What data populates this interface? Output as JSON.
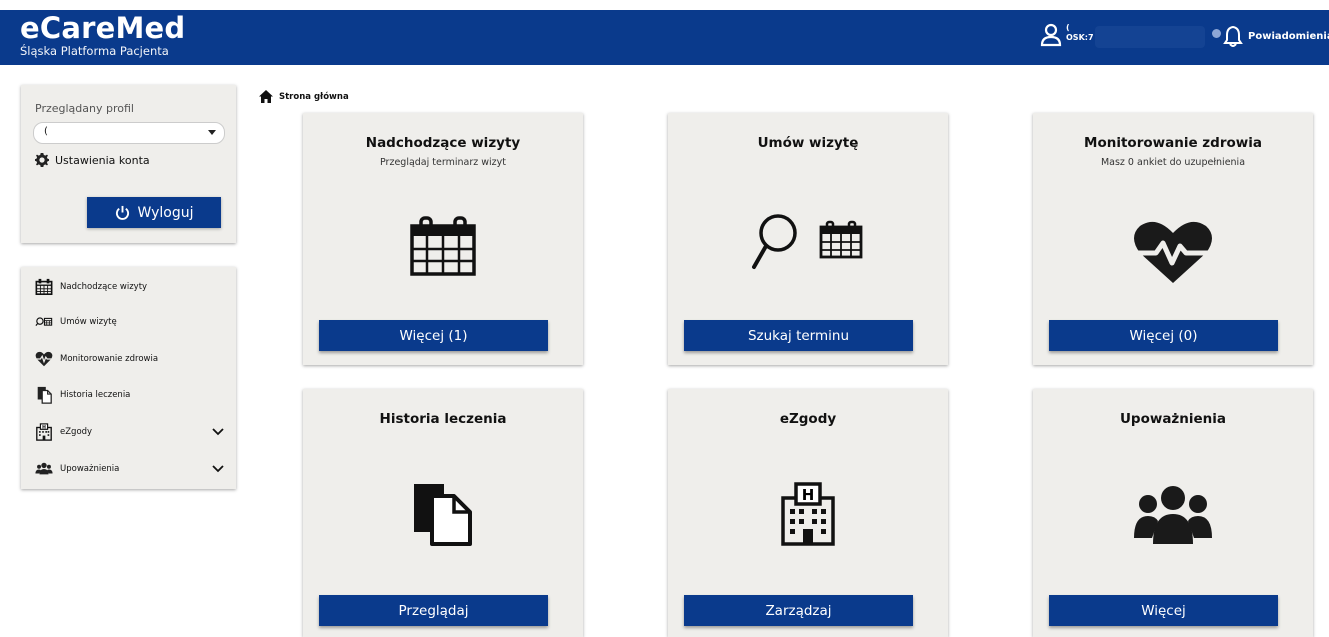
{
  "header": {
    "brand_title": "eCareMed",
    "brand_subtitle": "Śląska Platforma Pacjenta",
    "user_line1": "(",
    "user_line2": "OSK:7",
    "notifications_label": "Powiadomienia"
  },
  "profile": {
    "label": "Przeglądany profil",
    "selected": "(",
    "account_settings": "Ustawienia konta",
    "logout": "Wyloguj"
  },
  "nav": {
    "items": [
      {
        "label": "Nadchodzące wizyty",
        "icon": "calendar-icon"
      },
      {
        "label": "Umów wizytę",
        "icon": "search-calendar-icon"
      },
      {
        "label": "Monitorowanie zdrowia",
        "icon": "heartbeat-icon"
      },
      {
        "label": "Historia leczenia",
        "icon": "documents-icon"
      },
      {
        "label": "eZgody",
        "icon": "hospital-icon",
        "expandable": true
      },
      {
        "label": "Upoważnienia",
        "icon": "users-icon",
        "expandable": true
      }
    ]
  },
  "breadcrumb": {
    "home": "Strona główna"
  },
  "cards": [
    {
      "title": "Nadchodzące wizyty",
      "subtitle": "Przeglądaj terminarz wizyt",
      "button": "Więcej (1)",
      "icon": "calendar-icon"
    },
    {
      "title": "Umów wizytę",
      "subtitle": "",
      "button": "Szukaj terminu",
      "icon": "search-calendar-icon"
    },
    {
      "title": "Monitorowanie zdrowia",
      "subtitle": "Masz 0 ankiet do uzupełnienia",
      "button": "Więcej (0)",
      "icon": "heartbeat-icon"
    },
    {
      "title": "Historia leczenia",
      "subtitle": "",
      "button": "Przeglądaj",
      "icon": "documents-icon"
    },
    {
      "title": "eZgody",
      "subtitle": "",
      "button": "Zarządzaj",
      "icon": "hospital-icon"
    },
    {
      "title": "Upoważnienia",
      "subtitle": "",
      "button": "Więcej",
      "icon": "users-icon"
    }
  ],
  "colors": {
    "primary": "#0a3a8c",
    "panel": "#efeeeb"
  }
}
